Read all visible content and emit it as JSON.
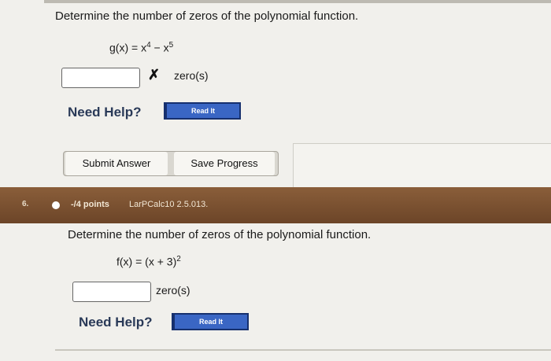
{
  "question5": {
    "prompt": "Determine the number of zeros of the polynomial function.",
    "formula_prefix": "g(x) = x",
    "exp1": "4",
    "formula_mid": " − x",
    "exp2": "5",
    "answer_value": "",
    "result_mark": "✗",
    "unit": "zero(s)",
    "need_help": "Need Help?",
    "read_it": "Read It"
  },
  "buttons": {
    "submit": "Submit Answer",
    "save": "Save Progress"
  },
  "question6": {
    "number": "6.",
    "points": "-/4 points",
    "reference": "LarPCalc10 2.5.013.",
    "prompt": "Determine the number of zeros of the polynomial function.",
    "formula_prefix": "f(x) = (x + 3)",
    "exp": "2",
    "answer_value": "",
    "unit": "zero(s)",
    "need_help": "Need Help?",
    "read_it": "Read It"
  }
}
